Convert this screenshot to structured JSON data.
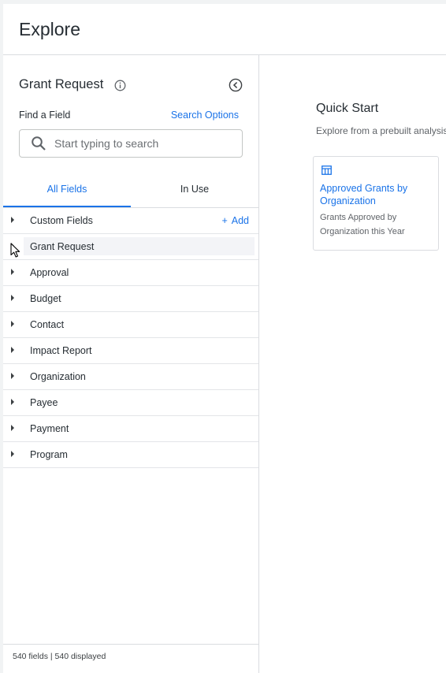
{
  "app": {
    "title": "Explore"
  },
  "sidebar": {
    "explore_name": "Grant Request",
    "find_label": "Find a Field",
    "search_options": "Search Options",
    "search_placeholder": "Start typing to search",
    "tabs": [
      {
        "label": "All Fields",
        "active": true
      },
      {
        "label": "In Use",
        "active": false
      }
    ],
    "add_label": "Add",
    "fields": [
      {
        "label": "Custom Fields"
      },
      {
        "label": "Grant Request"
      },
      {
        "label": "Approval"
      },
      {
        "label": "Budget"
      },
      {
        "label": "Contact"
      },
      {
        "label": "Impact Report"
      },
      {
        "label": "Organization"
      },
      {
        "label": "Payee"
      },
      {
        "label": "Payment"
      },
      {
        "label": "Program"
      }
    ],
    "footer": "540 fields | 540 displayed"
  },
  "main": {
    "quick_start_title": "Quick Start",
    "quick_start_subtitle": "Explore from a prebuilt analysis",
    "cards": [
      {
        "title": "Approved Grants by Organization",
        "description": "Grants Approved by Organization this Year"
      }
    ]
  },
  "colors": {
    "accent": "#1a73e8",
    "text": "#262d33",
    "border": "#dadce0"
  }
}
